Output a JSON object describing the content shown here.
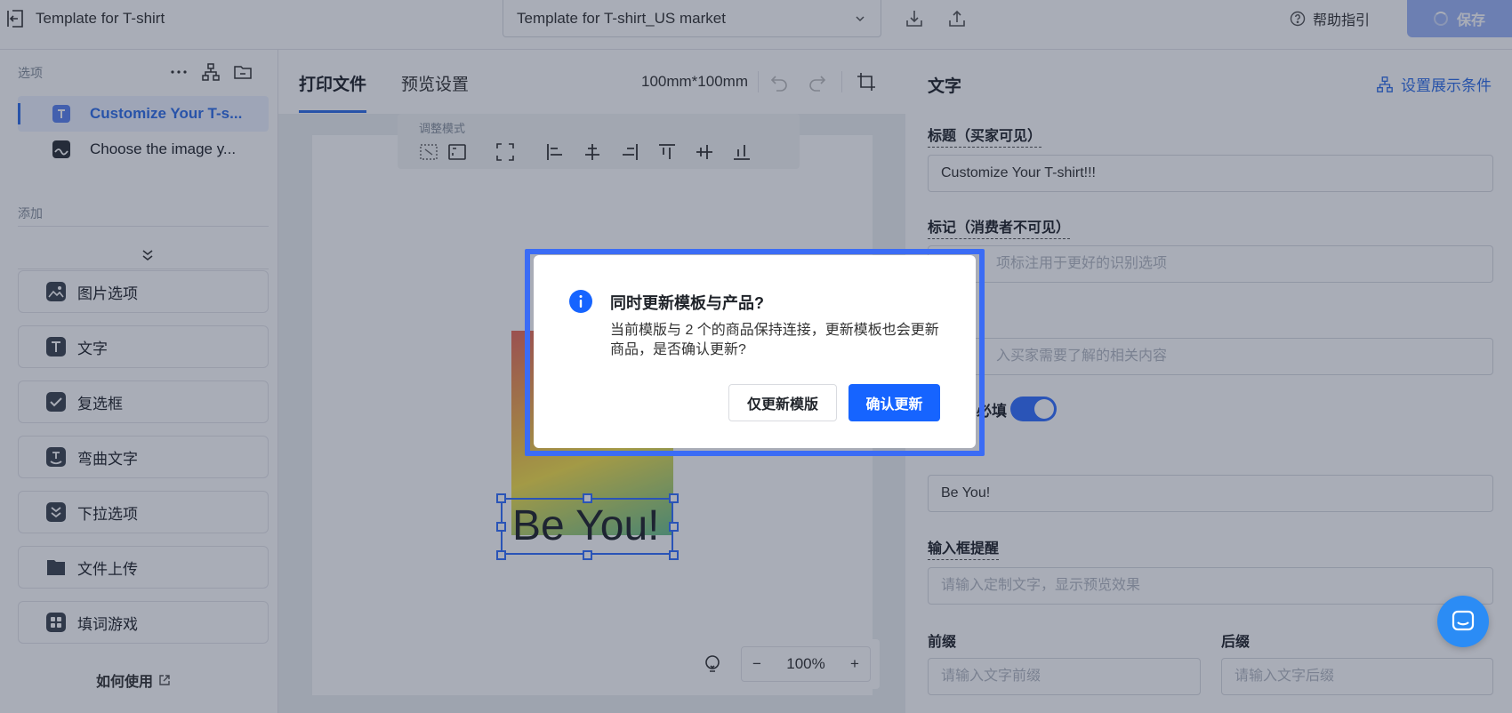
{
  "topbar": {
    "title": "Template for T-shirt",
    "template_select": "Template for T-shirt_US market",
    "help_label": "帮助指引",
    "save_label": "保存"
  },
  "sidebar": {
    "options_label": "选项",
    "options": [
      {
        "label": "Customize Your T-s...",
        "icon": "text-box-icon",
        "active": true
      },
      {
        "label": "Choose the image y...",
        "icon": "image-icon",
        "active": false
      }
    ],
    "add_label": "添加",
    "add_items": [
      {
        "label": "图片选项",
        "icon": "image-option-icon"
      },
      {
        "label": "文字",
        "icon": "text-icon"
      },
      {
        "label": "复选框",
        "icon": "checkbox-icon"
      },
      {
        "label": "弯曲文字",
        "icon": "curved-text-icon"
      },
      {
        "label": "下拉选项",
        "icon": "dropdown-icon"
      },
      {
        "label": "文件上传",
        "icon": "file-upload-icon"
      },
      {
        "label": "填词游戏",
        "icon": "word-game-icon"
      }
    ],
    "how_to_use": "如何使用"
  },
  "canvas": {
    "tabs": [
      "打印文件",
      "预览设置"
    ],
    "size": "100mm*100mm",
    "mode_label": "调整模式",
    "design_text": "Be You!",
    "zoom_minus": "−",
    "zoom": "100%",
    "zoom_plus": "+"
  },
  "right_panel": {
    "title": "文字",
    "condition_link": "设置展示条件",
    "fields": {
      "title_label": "标题（买家可见）",
      "title_value": "Customize Your T-shirt!!!",
      "mark_label": "标记（消费者不可见）",
      "mark_placeholder": "项标注用于更好的识别选项",
      "desc_placeholder": "入买家需要了解的相关内容",
      "required_label": "必填",
      "default_value": "Be You!",
      "prompt_label": "输入框提醒",
      "prompt_placeholder": "请输入定制文字，显示预览效果",
      "prefix_label": "前缀",
      "prefix_placeholder": "请输入文字前缀",
      "suffix_label": "后缀",
      "suffix_placeholder": "请输入文字后缀"
    }
  },
  "dialog": {
    "title": "同时更新模板与产品?",
    "body": "当前模版与 2 个的商品保持连接，更新模板也会更新商品，是否确认更新?",
    "secondary_button": "仅更新模版",
    "primary_button": "确认更新"
  },
  "colors": {
    "accent": "#2f6ee8",
    "primary_button": "#1664ff",
    "dialog_outline": "#3b6cf5"
  }
}
